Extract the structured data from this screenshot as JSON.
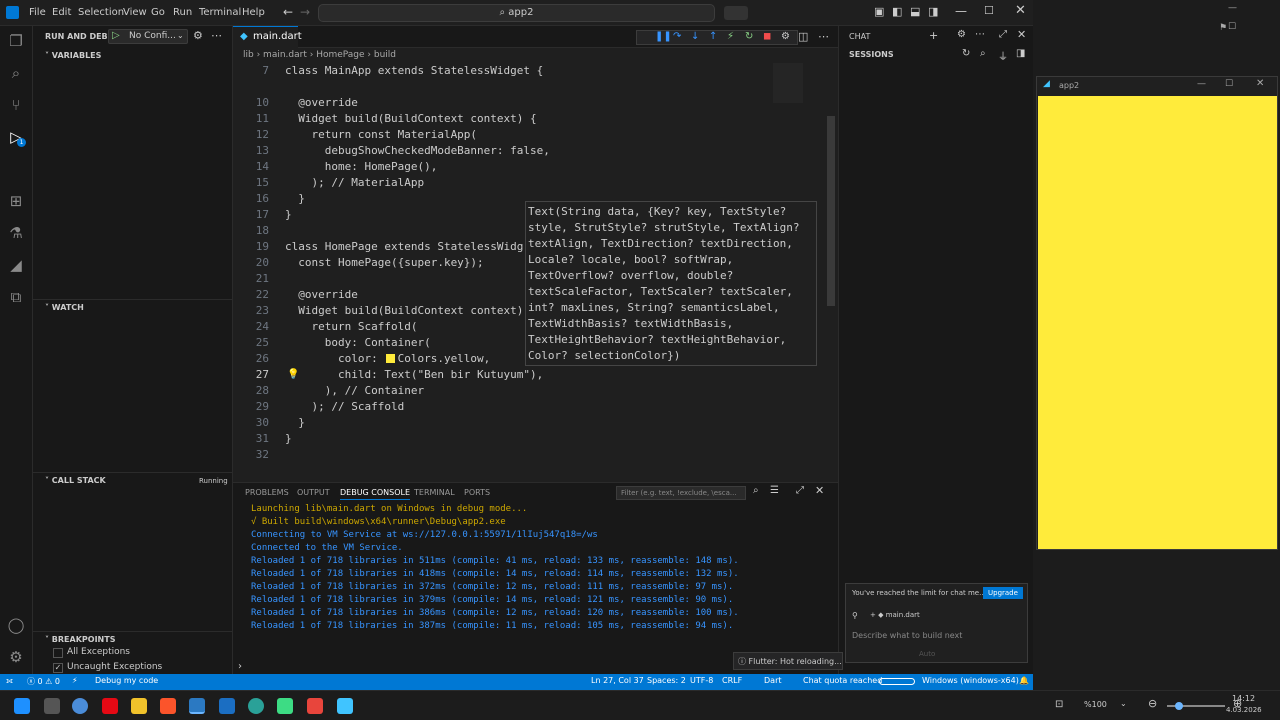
{
  "titlebar": {
    "menus": [
      "File",
      "Edit",
      "Selection",
      "View",
      "Go",
      "Run",
      "Terminal",
      "Help"
    ],
    "search": "app2"
  },
  "sidebar": {
    "run_title": "RUN AND DEBUG",
    "config": "No Confi...",
    "variables": "VARIABLES",
    "watch": "WATCH",
    "callstack": "CALL STACK",
    "callstack_status": "Running",
    "breakpoints": "BREAKPOINTS",
    "bp_all": "All Exceptions",
    "bp_uncaught": "Uncaught Exceptions"
  },
  "activity_badge": "1",
  "editor": {
    "tab": "main.dart",
    "crumbs": [
      "lib",
      "main.dart",
      "HomePage",
      "build"
    ],
    "lines": [
      {
        "n": "7",
        "t": "class MainApp extends StatelessWidget {"
      },
      {
        "n": "",
        "t": ""
      },
      {
        "n": "10",
        "t": "  @override"
      },
      {
        "n": "11",
        "t": "  Widget build(BuildContext context) {"
      },
      {
        "n": "12",
        "t": "    return const MaterialApp("
      },
      {
        "n": "13",
        "t": "      debugShowCheckedModeBanner: false,"
      },
      {
        "n": "14",
        "t": "      home: HomePage(),"
      },
      {
        "n": "15",
        "t": "    ); // MaterialApp"
      },
      {
        "n": "16",
        "t": "  }"
      },
      {
        "n": "17",
        "t": "}"
      },
      {
        "n": "18",
        "t": ""
      },
      {
        "n": "19",
        "t": "class HomePage extends StatelessWidg"
      },
      {
        "n": "20",
        "t": "  const HomePage({super.key});"
      },
      {
        "n": "21",
        "t": ""
      },
      {
        "n": "22",
        "t": "  @override"
      },
      {
        "n": "23",
        "t": "  Widget build(BuildContext context)"
      },
      {
        "n": "24",
        "t": "    return Scaffold("
      },
      {
        "n": "25",
        "t": "      body: Container("
      },
      {
        "n": "26",
        "t": "        color:   Colors.yellow,"
      },
      {
        "n": "27",
        "t": "        child: Text(\"Ben bir Kutuyum\"),"
      },
      {
        "n": "28",
        "t": "      ), // Container"
      },
      {
        "n": "29",
        "t": "    ); // Scaffold"
      },
      {
        "n": "30",
        "t": "  }"
      },
      {
        "n": "31",
        "t": "}"
      },
      {
        "n": "32",
        "t": ""
      }
    ],
    "hover": [
      "Text(String data, {Key? key, TextStyle?",
      "style, StrutStyle? strutStyle, TextAlign?",
      "textAlign, TextDirection? textDirection,",
      "Locale? locale, bool? softWrap,",
      "TextOverflow? overflow, double?",
      "textScaleFactor, TextScaler? textScaler,",
      "int? maxLines, String? semanticsLabel,",
      "TextWidthBasis? textWidthBasis,",
      "TextHeightBehavior? textHeightBehavior,",
      "Color? selectionColor})"
    ]
  },
  "panel": {
    "tabs": [
      "PROBLEMS",
      "OUTPUT",
      "DEBUG CONSOLE",
      "TERMINAL",
      "PORTS"
    ],
    "filter": "Filter (e.g. text, !exclude, \\esca...",
    "log": [
      "Launching lib\\main.dart on Windows in debug mode...",
      "√ Built build\\windows\\x64\\runner\\Debug\\app2.exe",
      "Connecting to VM Service at ws://127.0.0.1:55971/1lIuj547q18=/ws",
      "Connected to the VM Service.",
      "Reloaded 1 of 718 libraries in 511ms (compile: 41 ms, reload: 133 ms, reassemble: 148 ms).",
      "Reloaded 1 of 718 libraries in 418ms (compile: 14 ms, reload: 114 ms, reassemble: 132 ms).",
      "Reloaded 1 of 718 libraries in 372ms (compile: 12 ms, reload: 111 ms, reassemble: 97 ms).",
      "Reloaded 1 of 718 libraries in 379ms (compile: 14 ms, reload: 121 ms, reassemble: 90 ms).",
      "Reloaded 1 of 718 libraries in 386ms (compile: 12 ms, reload: 120 ms, reassemble: 100 ms).",
      "Reloaded 1 of 718 libraries in 387ms (compile: 11 ms, reload: 105 ms, reassemble: 94 ms)."
    ]
  },
  "chat": {
    "title": "CHAT",
    "sessions": "SESSIONS",
    "limit": "You've reached the limit for chat me...",
    "upgrade": "Upgrade",
    "file": "main.dart",
    "placeholder": "Describe what to build next",
    "mode": "Auto",
    "toast": "Flutter: Hot reloading..."
  },
  "status": {
    "errors": "0",
    "warnings": "0",
    "debug": "Debug my code",
    "pos": "Ln 27, Col 37",
    "spaces": "Spaces: 2",
    "enc": "UTF-8",
    "eol": "CRLF",
    "lang": "Dart",
    "quota": "Chat quota reached",
    "device": "Windows (windows-x64)"
  },
  "app_window": {
    "title": "app2",
    "bg": "#ffeb3b"
  },
  "taskbar": {
    "zoom": "%100",
    "time": "14:12",
    "date": "4.03.2026"
  }
}
